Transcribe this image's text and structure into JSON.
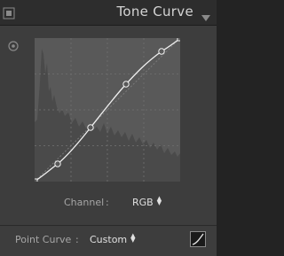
{
  "panel": {
    "title": "Tone Curve",
    "icons": {
      "toggle": "panel-switch-icon",
      "collapse": "triangle-down-icon",
      "target": "target-adjustment-icon",
      "edit_curve": "edit-point-curve-icon"
    }
  },
  "channel": {
    "label": "Channel",
    "colon": ":",
    "value": "RGB"
  },
  "point_curve": {
    "label": "Point Curve",
    "colon": ":",
    "value": "Custom"
  },
  "colors": {
    "panel_bg": "#3d3d3d",
    "header_bg": "#2d2d2d",
    "curve_bg": "#595959",
    "histogram": "#4a4a4a",
    "curve_line": "#f0f0f0"
  }
}
